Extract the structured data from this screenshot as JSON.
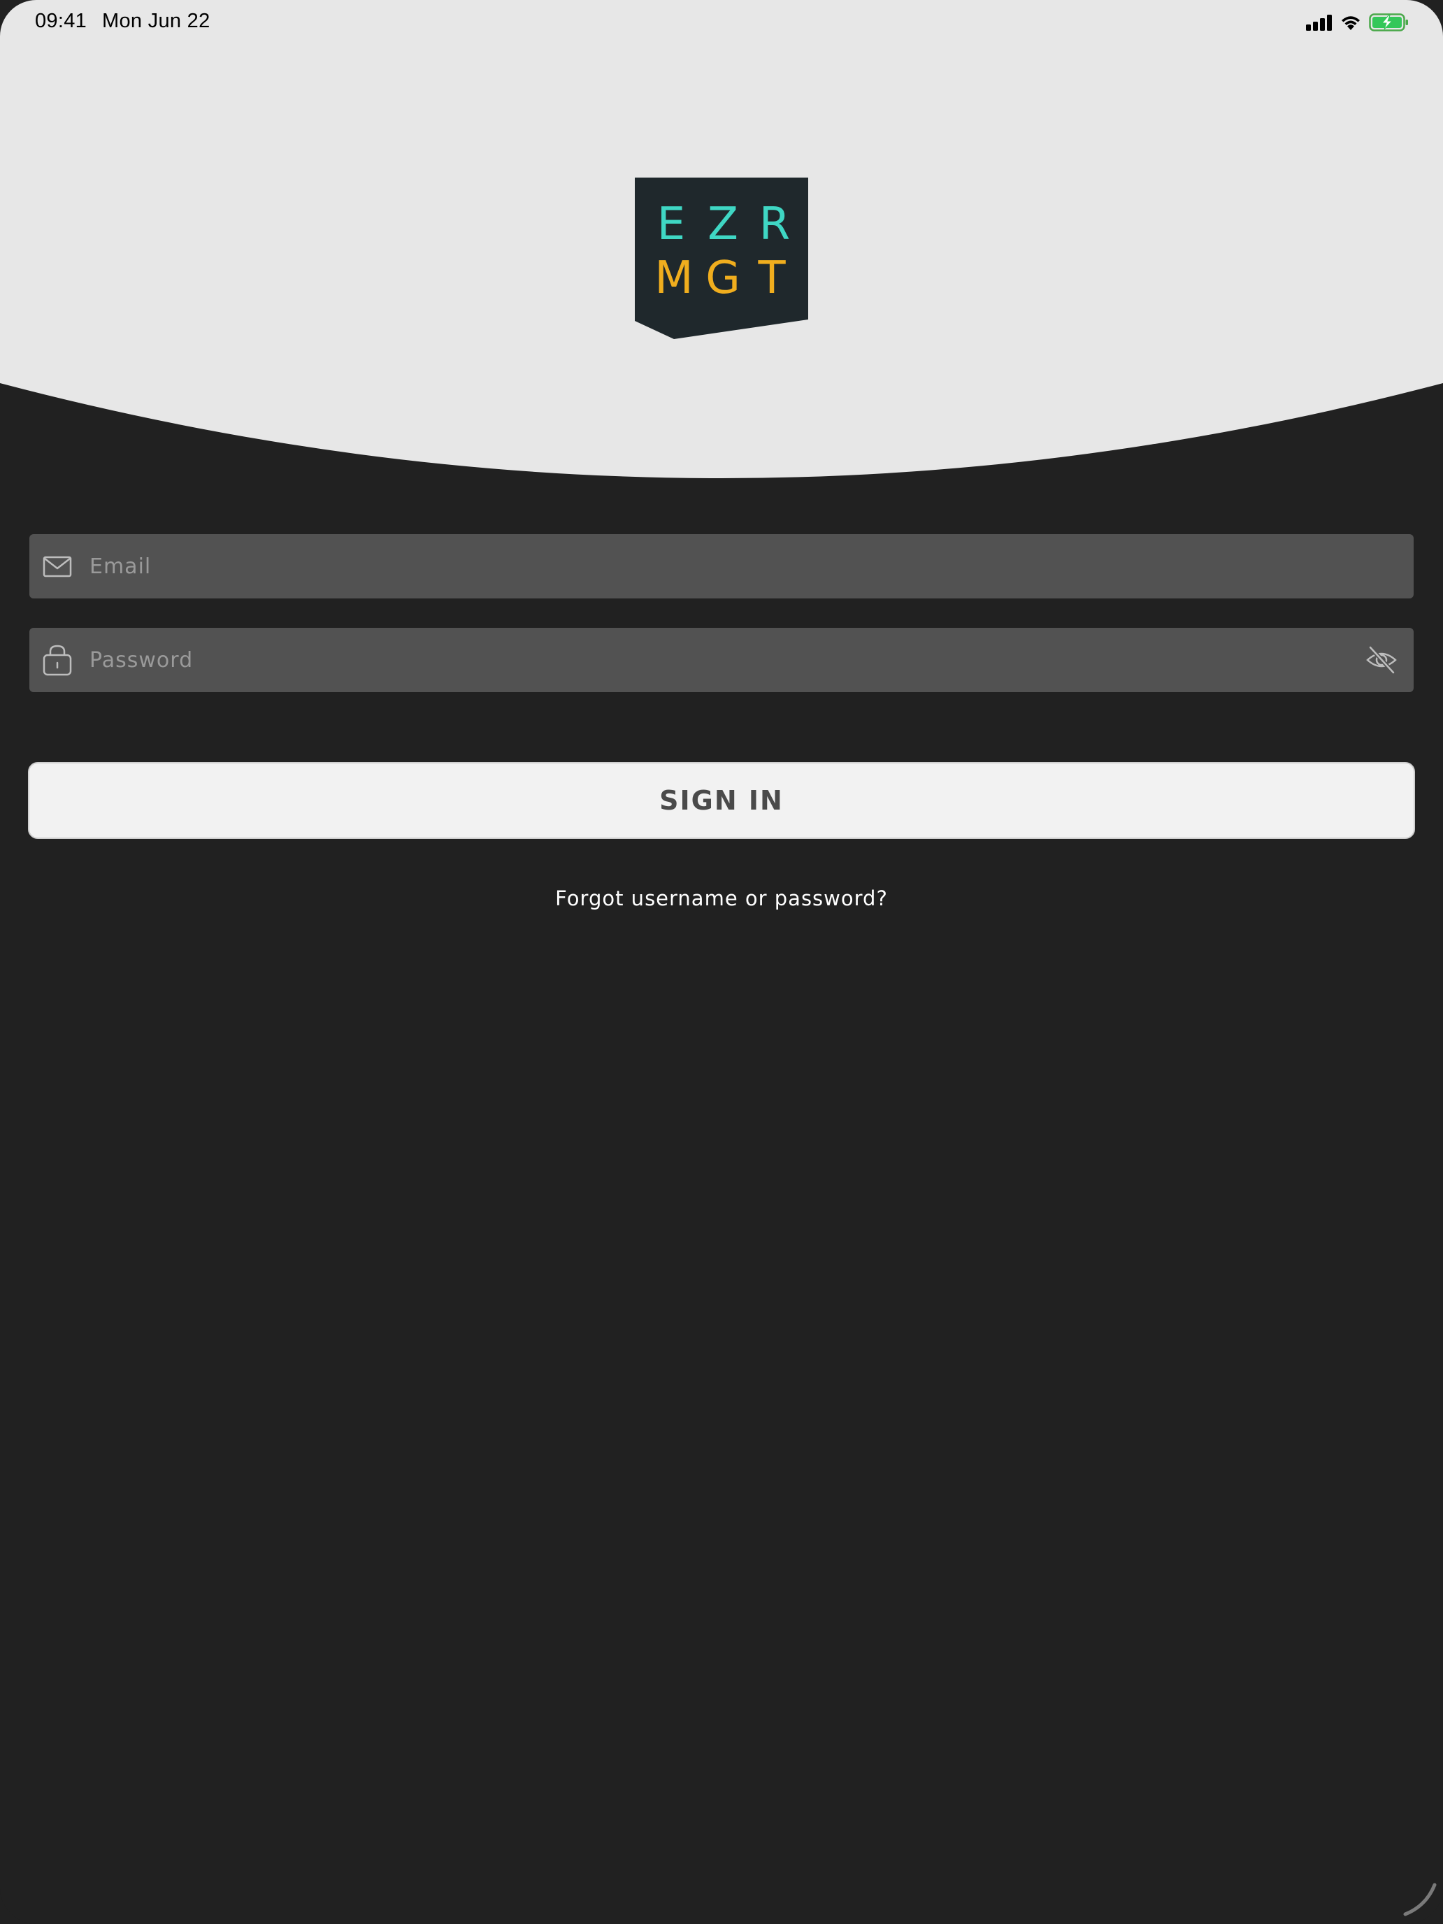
{
  "status_bar": {
    "time": "09:41",
    "date": "Mon Jun 22",
    "icons": [
      "cellular-signal-icon",
      "wifi-icon",
      "battery-charging-icon"
    ]
  },
  "logo": {
    "row1": [
      "E",
      "Z",
      "R"
    ],
    "row2": [
      "M",
      "G",
      "T"
    ],
    "colors": {
      "badge": "#1f282c",
      "row1": "#3fd7c4",
      "row2": "#f0ae1e"
    }
  },
  "login_form": {
    "email": {
      "placeholder": "Email",
      "value": "",
      "icon": "envelope-icon"
    },
    "password": {
      "placeholder": "Password",
      "value": "",
      "icon": "lock-icon",
      "toggle_icon": "eye-slash-icon"
    },
    "sign_in_label": "SIGN IN",
    "forgot_link": "Forgot username or password?"
  },
  "colors": {
    "header_bg": "#e7e7e7",
    "page_bg": "#212121",
    "field_bg": "#525252",
    "button_bg": "#f2f2f2",
    "button_text": "#4a4a4a"
  }
}
